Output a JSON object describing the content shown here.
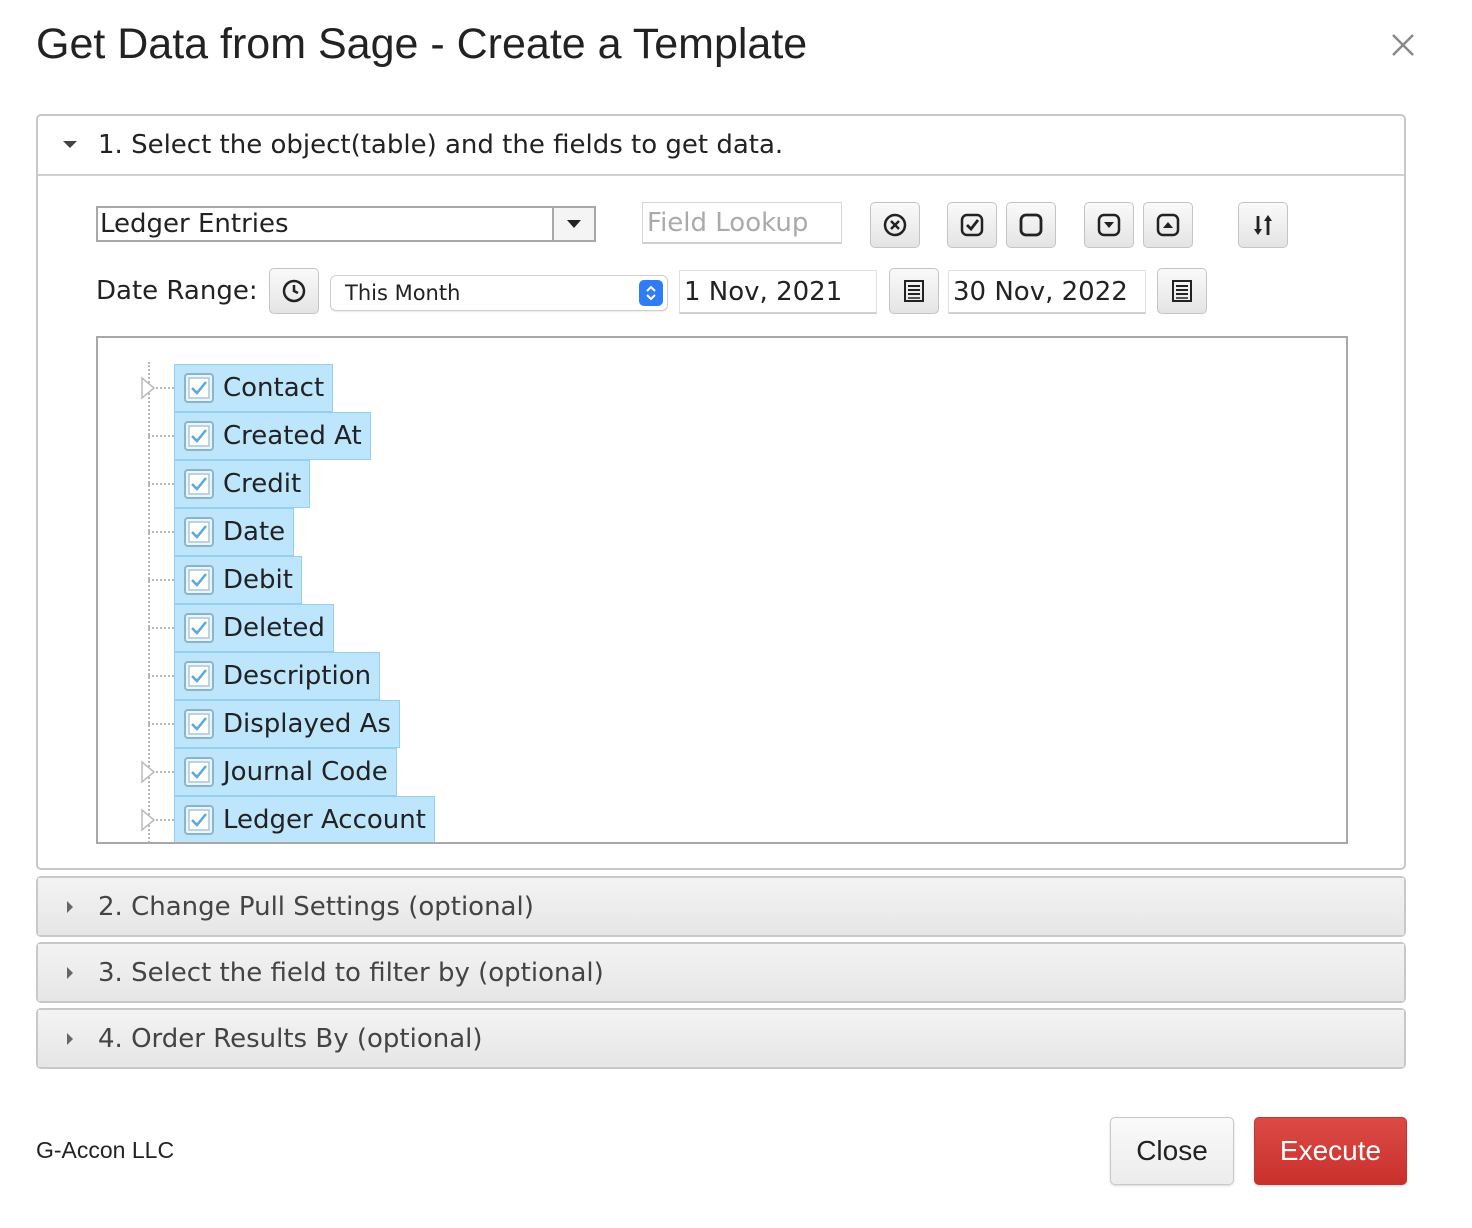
{
  "dialog": {
    "title": "Get Data from Sage - Create a Template"
  },
  "sections": [
    {
      "label": "1. Select the object(table) and the fields to get data.",
      "expanded": true
    },
    {
      "label": "2. Change Pull Settings (optional)",
      "expanded": false
    },
    {
      "label": "3. Select the field to filter by (optional)",
      "expanded": false
    },
    {
      "label": "4. Order Results By (optional)",
      "expanded": false
    }
  ],
  "object_select": {
    "value": "Ledger Entries"
  },
  "field_lookup": {
    "placeholder": "Field Lookup"
  },
  "toolbar_icons": [
    "clear-icon",
    "check-all-icon",
    "uncheck-all-icon",
    "expand-all-icon",
    "collapse-all-icon",
    "sort-icon"
  ],
  "date_range": {
    "label": "Date Range:",
    "preset": "This Month",
    "start": "1 Nov, 2021",
    "end": "30 Nov, 2022"
  },
  "fields": [
    {
      "label": "Contact",
      "checked": true,
      "expandable": true
    },
    {
      "label": "Created At",
      "checked": true,
      "expandable": false
    },
    {
      "label": "Credit",
      "checked": true,
      "expandable": false
    },
    {
      "label": "Date",
      "checked": true,
      "expandable": false
    },
    {
      "label": "Debit",
      "checked": true,
      "expandable": false
    },
    {
      "label": "Deleted",
      "checked": true,
      "expandable": false
    },
    {
      "label": "Description",
      "checked": true,
      "expandable": false
    },
    {
      "label": "Displayed As",
      "checked": true,
      "expandable": false
    },
    {
      "label": "Journal Code",
      "checked": true,
      "expandable": true
    },
    {
      "label": "Ledger Account",
      "checked": true,
      "expandable": true
    }
  ],
  "footer": {
    "company": "G-Accon LLC",
    "close_label": "Close",
    "execute_label": "Execute"
  },
  "colors": {
    "selected_chip": "#bde6fd",
    "execute": "#d0342f",
    "spinner": "#2f7cf6"
  }
}
